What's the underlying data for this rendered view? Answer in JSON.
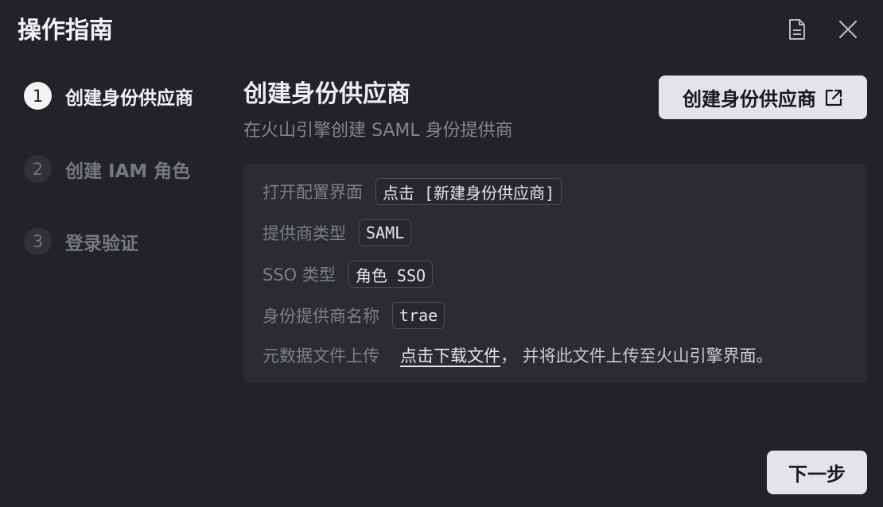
{
  "dialog": {
    "title": "操作指南",
    "doc_icon": "document-icon",
    "close_icon": "close-icon"
  },
  "steps": [
    {
      "number": "1",
      "label": "创建身份供应商",
      "state": "active"
    },
    {
      "number": "2",
      "label": "创建 IAM 角色",
      "state": "inactive"
    },
    {
      "number": "3",
      "label": "登录验证",
      "state": "inactive"
    }
  ],
  "main": {
    "title": "创建身份供应商",
    "subtitle": "在火山引擎创建 SAML 身份提供商",
    "action_button": {
      "label": "创建身份供应商",
      "icon": "external-link-icon"
    },
    "rows": [
      {
        "label": "打开配置界面",
        "value": "点击 [新建身份供应商]"
      },
      {
        "label": "提供商类型",
        "value": "SAML"
      },
      {
        "label": "SSO 类型",
        "value": "角色 SSO"
      },
      {
        "label": "身份提供商名称",
        "value": "trae"
      },
      {
        "label": "元数据文件上传",
        "link": "点击下载文件",
        "suffix": "， 并将此文件上传至火山引擎界面。"
      }
    ]
  },
  "footer": {
    "next_label": "下一步"
  },
  "colors": {
    "background": "#222327",
    "panel": "#2a2c30",
    "button_bg": "#e3e4e8",
    "muted_text": "#7c7f85"
  }
}
